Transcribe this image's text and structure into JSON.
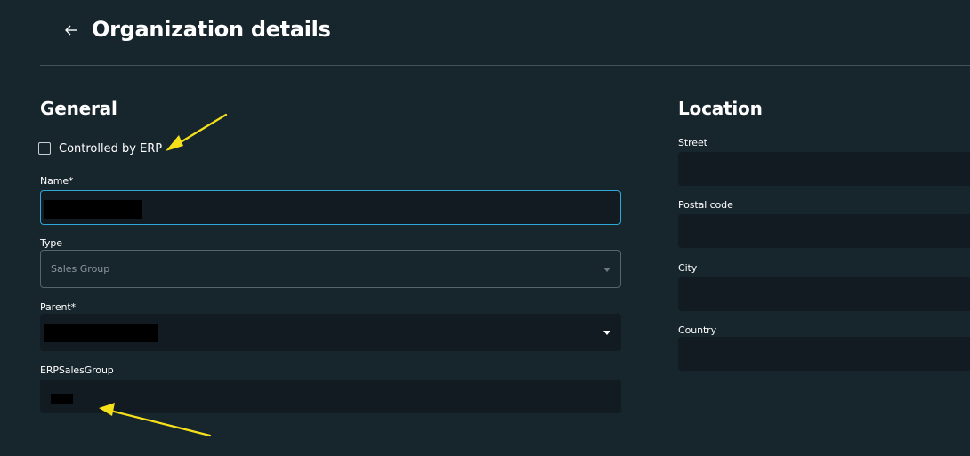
{
  "header": {
    "title": "Organization details",
    "back_icon": "arrow-left-icon"
  },
  "general": {
    "section_title": "General",
    "controlled_by_erp": {
      "label": "Controlled by ERP",
      "checked": false
    },
    "name": {
      "label": "Name*",
      "value": "[redacted]"
    },
    "type": {
      "label": "Type",
      "selected": "Sales Group"
    },
    "parent": {
      "label": "Parent*",
      "selected": "[redacted]"
    },
    "erp_sales_group": {
      "label": "ERPSalesGroup",
      "value": "[redacted]"
    }
  },
  "location": {
    "section_title": "Location",
    "street": {
      "label": "Street",
      "value": ""
    },
    "postal_code": {
      "label": "Postal code",
      "value": ""
    },
    "city": {
      "label": "City",
      "value": ""
    },
    "country": {
      "label": "Country",
      "value": ""
    }
  },
  "colors": {
    "background": "#17252d",
    "input_background": "#111b21",
    "focus_border": "#2fa8d8",
    "annotation_arrow": "#f5e11a"
  }
}
